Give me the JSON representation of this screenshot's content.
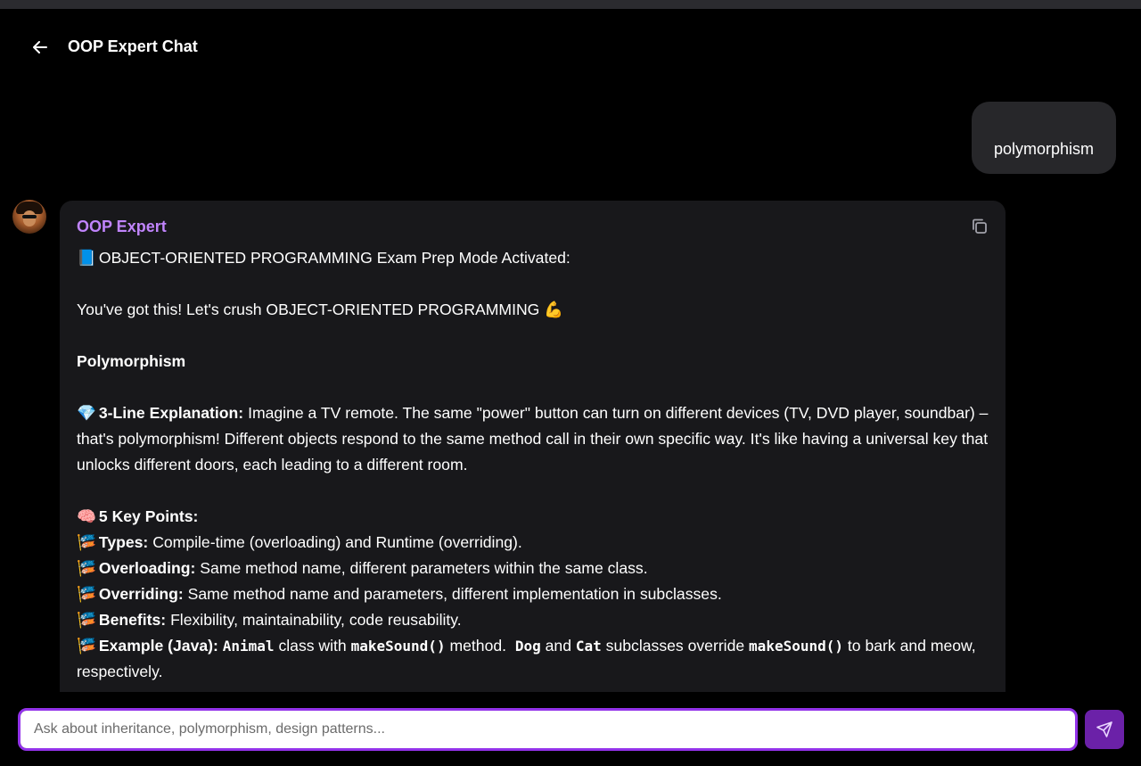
{
  "header": {
    "title": "OOP Expert Chat",
    "back_icon": "arrow-left-icon"
  },
  "user_message": {
    "text": "polymorphism"
  },
  "bot_message": {
    "sender": "OOP Expert",
    "intro_emoji": "📘",
    "intro": "OBJECT-ORIENTED PROGRAMMING Exam Prep Mode Activated:",
    "encouragement": "You've got this! Let's crush OBJECT-ORIENTED PROGRAMMING",
    "encouragement_emoji": "💪",
    "topic": "Polymorphism",
    "explanation_emoji": "💎",
    "explanation_label": "3-Line Explanation:",
    "explanation_text": "Imagine a TV remote.  The same \"power\" button can turn on different devices (TV, DVD player, soundbar) – that's polymorphism!  Different objects respond to the same method call in their own specific way.  It's like having a universal key that unlocks different doors, each leading to a different room.",
    "key_points_emoji": "🧠",
    "key_points_title": "5 Key Points:",
    "point_emoji": "🎏",
    "points": [
      {
        "label": "Types:",
        "text": "Compile-time (overloading) and Runtime (overriding)."
      },
      {
        "label": "Overloading:",
        "text": "Same method name, different parameters within the same class."
      },
      {
        "label": "Overriding:",
        "text": "Same method name and parameters, different implementation in subclasses."
      },
      {
        "label": "Benefits:",
        "text": "Flexibility, maintainability, code reusability."
      }
    ],
    "example": {
      "label": "Example (Java):",
      "code1": "Animal",
      "t1": "class with",
      "code2": "makeSound()",
      "t2": "method.",
      "code3": "Dog",
      "t3": "and",
      "code4": "Cat",
      "t4": "subclasses override",
      "code5": "makeSound()",
      "t5": "to bark and meow, respectively."
    },
    "copy_icon": "copy-icon"
  },
  "composer": {
    "placeholder": "Ask about inheritance, polymorphism, design patterns...",
    "value": "",
    "send_icon": "send-icon"
  },
  "colors": {
    "accent": "#9333ea",
    "sender": "#c084fc",
    "send_button": "#6b21a8",
    "card": "#18181b",
    "user_bubble": "#27272a"
  }
}
